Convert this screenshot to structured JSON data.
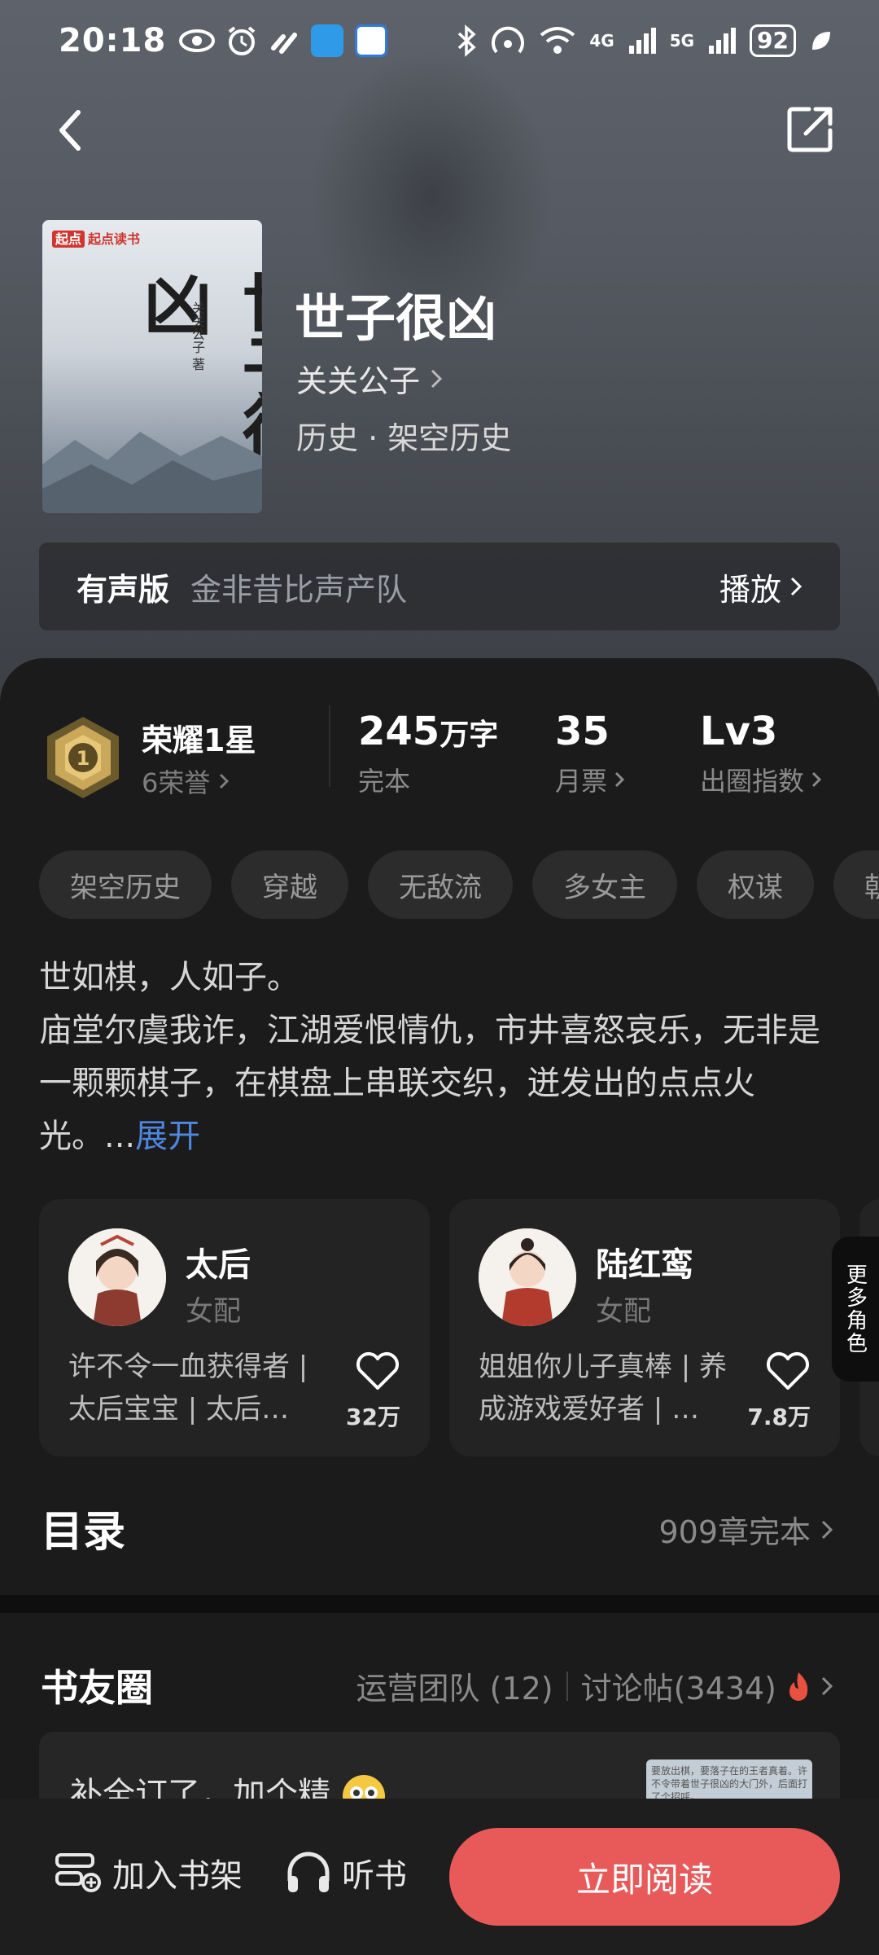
{
  "status_bar": {
    "time": "20:18",
    "battery": "92",
    "network_1": "4G",
    "network_2": "5G"
  },
  "book": {
    "title": "世子很凶",
    "author": "关关公子",
    "genre": "历史 · 架空历史",
    "cover_brand": "起点读书",
    "cover_title": "世子很凶",
    "cover_author": "关关公子 著"
  },
  "audio": {
    "label": "有声版",
    "team": "金非昔比声产队",
    "play": "播放"
  },
  "stats": {
    "honor_title": "荣耀1星",
    "honor_sub": "6荣誉",
    "words_value": "245",
    "words_unit": "万字",
    "words_label": "完本",
    "tickets_value": "35",
    "tickets_label": "月票",
    "level_value": "Lv3",
    "level_label": "出圈指数"
  },
  "tags": [
    "架空历史",
    "穿越",
    "无敌流",
    "多女主",
    "权谋",
    "朝"
  ],
  "intro": {
    "line1": "世如棋，人如子。",
    "line2": "庙堂尔虞我诈，江湖爱恨情仇，市井喜怒哀乐，无非是一颗颗棋子，在棋盘上串联交织，迸发出的点点火光。...",
    "more": "展开"
  },
  "roles": [
    {
      "name": "太后",
      "role": "女配",
      "desc": "许不令一血获得者 | 太后宝宝 | 太后…",
      "count": "32万"
    },
    {
      "name": "陆红鸾",
      "role": "女配",
      "desc": "姐姐你儿子真棒 | 养成游戏爱好者 | …",
      "count": "7.8万"
    }
  ],
  "more_roles": "更多角色",
  "toc": {
    "title": "目录",
    "summary": "909章完本"
  },
  "circle": {
    "title": "书友圈",
    "team": "运营团队 (12)",
    "posts": "讨论帖(3434)",
    "post_text": "补全订了，加个精",
    "thumb_text": "要放出棋，要落子在的王者真着。许不令带着世子很凶的大门外，后面打了个招呼。"
  },
  "bottom": {
    "shelf": "加入书架",
    "listen": "听书",
    "read": "立即阅读"
  },
  "colors": {
    "accent_red": "#e85959",
    "link_blue": "#4e86e0",
    "panel_bg": "#1b1b1b"
  }
}
